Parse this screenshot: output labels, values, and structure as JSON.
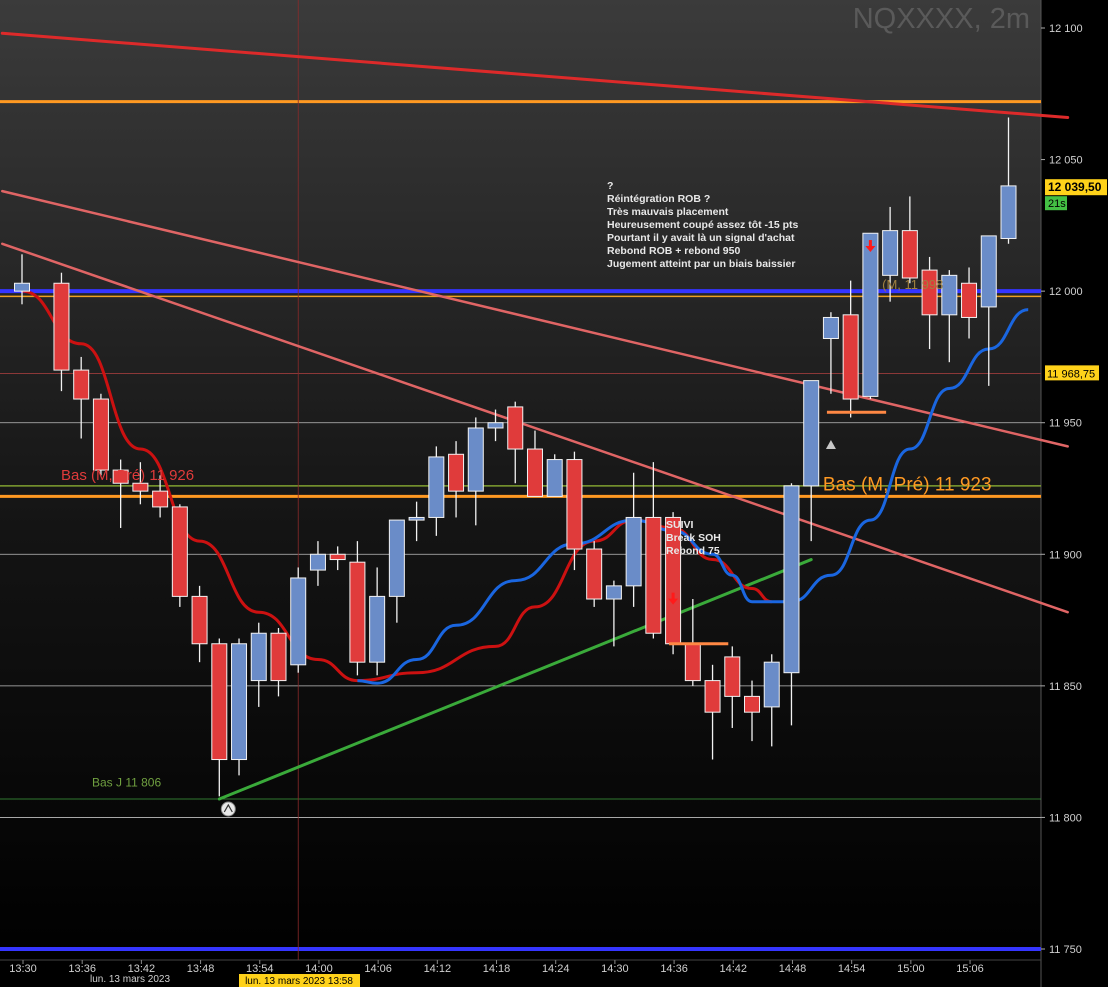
{
  "chart_data": {
    "type": "candlestick",
    "title": "NQXXXX, 2m",
    "symbol": "NQXXXX",
    "timeframe": "2m",
    "ylim": [
      11738,
      12109
    ],
    "y_ticks": [
      {
        "value": 12100,
        "label": "12 100"
      },
      {
        "value": 12050,
        "label": "12 050"
      },
      {
        "value": 12000,
        "label": "12 000"
      },
      {
        "value": 11950,
        "label": "11 950"
      },
      {
        "value": 11900,
        "label": "11 900"
      },
      {
        "value": 11850,
        "label": "11 850"
      },
      {
        "value": 11800,
        "label": "11 800"
      },
      {
        "value": 11750,
        "label": "11 750"
      }
    ],
    "x_ticks": [
      "13:30",
      "13:36",
      "13:42",
      "13:48",
      "13:54",
      "14:00",
      "14:06",
      "14:12",
      "14:18",
      "14:24",
      "14:30",
      "14:36",
      "14:42",
      "14:48",
      "14:54",
      "15:00",
      "15:06"
    ],
    "x_date_label": "lun. 13 mars 2023",
    "crosshair_time_label": "lun. 13 mars 2023 13:58",
    "last_price": {
      "label": "12 039,50",
      "timer": "21s"
    },
    "marker_price": {
      "label": "11 968,75",
      "value": 11968.75
    },
    "up_color": "#6a8cc8",
    "down_color": "#e03b3b",
    "candles": [
      {
        "time": "13:30",
        "open": 12000,
        "high": 12014,
        "low": 11995,
        "close": 12003
      },
      {
        "time": "13:34",
        "open": 12003,
        "high": 12007,
        "low": 11962,
        "close": 11970
      },
      {
        "time": "13:36",
        "open": 11970,
        "high": 11975,
        "low": 11944,
        "close": 11959
      },
      {
        "time": "13:38",
        "open": 11959,
        "high": 11961,
        "low": 11930,
        "close": 11932
      },
      {
        "time": "13:40",
        "open": 11932,
        "high": 11936,
        "low": 11910,
        "close": 11927
      },
      {
        "time": "13:42",
        "open": 11927,
        "high": 11935,
        "low": 11919,
        "close": 11924
      },
      {
        "time": "13:44",
        "open": 11924,
        "high": 11930,
        "low": 11914,
        "close": 11918
      },
      {
        "time": "13:46",
        "open": 11918,
        "high": 11919,
        "low": 11880,
        "close": 11884
      },
      {
        "time": "13:48",
        "open": 11884,
        "high": 11888,
        "low": 11859,
        "close": 11866
      },
      {
        "time": "13:50",
        "open": 11866,
        "high": 11868,
        "low": 11808,
        "close": 11822
      },
      {
        "time": "13:52",
        "open": 11822,
        "high": 11868,
        "low": 11816,
        "close": 11866
      },
      {
        "time": "13:54",
        "open": 11852,
        "high": 11874,
        "low": 11842,
        "close": 11870
      },
      {
        "time": "13:56",
        "open": 11870,
        "high": 11872,
        "low": 11846,
        "close": 11852
      },
      {
        "time": "13:58",
        "open": 11858,
        "high": 11895,
        "low": 11855,
        "close": 11891
      },
      {
        "time": "14:00",
        "open": 11894,
        "high": 11905,
        "low": 11888,
        "close": 11900
      },
      {
        "time": "14:02",
        "open": 11900,
        "high": 11903,
        "low": 11894,
        "close": 11898
      },
      {
        "time": "14:04",
        "open": 11897,
        "high": 11905,
        "low": 11854,
        "close": 11859
      },
      {
        "time": "14:06",
        "open": 11859,
        "high": 11895,
        "low": 11854,
        "close": 11884
      },
      {
        "time": "14:08",
        "open": 11884,
        "high": 11912,
        "low": 11874,
        "close": 11913
      },
      {
        "time": "14:10",
        "open": 11913,
        "high": 11920,
        "low": 11905,
        "close": 11914
      },
      {
        "time": "14:12",
        "open": 11914,
        "high": 11941,
        "low": 11907,
        "close": 11937
      },
      {
        "time": "14:14",
        "open": 11938,
        "high": 11943,
        "low": 11914,
        "close": 11924
      },
      {
        "time": "14:16",
        "open": 11924,
        "high": 11952,
        "low": 11911,
        "close": 11948
      },
      {
        "time": "14:18",
        "open": 11948,
        "high": 11955,
        "low": 11943,
        "close": 11950
      },
      {
        "time": "14:20",
        "open": 11956,
        "high": 11958,
        "low": 11927,
        "close": 11940
      },
      {
        "time": "14:22",
        "open": 11940,
        "high": 11947,
        "low": 11922,
        "close": 11922
      },
      {
        "time": "14:24",
        "open": 11922,
        "high": 11938,
        "low": 11922,
        "close": 11936
      },
      {
        "time": "14:26",
        "open": 11936,
        "high": 11939,
        "low": 11894,
        "close": 11902
      },
      {
        "time": "14:28",
        "open": 11902,
        "high": 11905,
        "low": 11880,
        "close": 11883
      },
      {
        "time": "14:30",
        "open": 11883,
        "high": 11890,
        "low": 11865,
        "close": 11888
      },
      {
        "time": "14:32",
        "open": 11888,
        "high": 11931,
        "low": 11880,
        "close": 11914
      },
      {
        "time": "14:34",
        "open": 11914,
        "high": 11935,
        "low": 11868,
        "close": 11870
      },
      {
        "time": "14:36",
        "open": 11914,
        "high": 11916,
        "low": 11862,
        "close": 11866
      },
      {
        "time": "14:38",
        "open": 11866,
        "high": 11883,
        "low": 11850,
        "close": 11852
      },
      {
        "time": "14:40",
        "open": 11852,
        "high": 11858,
        "low": 11822,
        "close": 11840
      },
      {
        "time": "14:42",
        "open": 11861,
        "high": 11865,
        "low": 11834,
        "close": 11846
      },
      {
        "time": "14:44",
        "open": 11846,
        "high": 11852,
        "low": 11829,
        "close": 11840
      },
      {
        "time": "14:46",
        "open": 11842,
        "high": 11862,
        "low": 11827,
        "close": 11859
      },
      {
        "time": "14:48",
        "open": 11855,
        "high": 11927,
        "low": 11835,
        "close": 11926
      },
      {
        "time": "14:50",
        "open": 11926,
        "high": 11966,
        "low": 11905,
        "close": 11966
      },
      {
        "time": "14:52",
        "open": 11982,
        "high": 11992,
        "low": 11961,
        "close": 11990
      },
      {
        "time": "14:54",
        "open": 11991,
        "high": 12004,
        "low": 11952,
        "close": 11959
      },
      {
        "time": "14:56",
        "open": 11960,
        "high": 12008,
        "low": 11959,
        "close": 12022
      },
      {
        "time": "14:58",
        "open": 12006,
        "high": 12032,
        "low": 11996,
        "close": 12023
      },
      {
        "time": "15:00",
        "open": 12023,
        "high": 12036,
        "low": 12003,
        "close": 12005
      },
      {
        "time": "15:02",
        "open": 12008,
        "high": 12013,
        "low": 11978,
        "close": 11991
      },
      {
        "time": "15:04",
        "open": 11991,
        "high": 12008,
        "low": 11973,
        "close": 12006
      },
      {
        "time": "15:06",
        "open": 12003,
        "high": 12009,
        "low": 11982,
        "close": 11990
      },
      {
        "time": "15:08",
        "open": 11994,
        "high": 12019,
        "low": 11964,
        "close": 12021
      },
      {
        "time": "15:10",
        "open": 12020,
        "high": 12066,
        "low": 12018,
        "close": 12040
      }
    ],
    "moving_averages": [
      {
        "name": "slow-ma",
        "color": "#cc1111",
        "points": [
          {
            "time": "13:30",
            "value": 12000
          },
          {
            "time": "13:36",
            "value": 11980
          },
          {
            "time": "13:42",
            "value": 11940
          },
          {
            "time": "13:48",
            "value": 11905
          },
          {
            "time": "13:54",
            "value": 11878
          },
          {
            "time": "14:00",
            "value": 11860
          },
          {
            "time": "14:04",
            "value": 11852
          },
          {
            "time": "14:10",
            "value": 11855
          },
          {
            "time": "14:18",
            "value": 11865
          },
          {
            "time": "14:22",
            "value": 11880
          },
          {
            "time": "14:28",
            "value": 11905
          },
          {
            "time": "14:32",
            "value": 11913
          },
          {
            "time": "14:36",
            "value": 11910
          },
          {
            "time": "14:40",
            "value": 11898
          },
          {
            "time": "14:44",
            "value": 11887
          },
          {
            "time": "14:46",
            "value": 11882
          }
        ]
      },
      {
        "name": "fast-ma",
        "color": "#1a66e0",
        "points": [
          {
            "time": "14:04",
            "value": 11852
          },
          {
            "time": "14:06",
            "value": 11851
          },
          {
            "time": "14:10",
            "value": 11860
          },
          {
            "time": "14:14",
            "value": 11873
          },
          {
            "time": "14:20",
            "value": 11890
          },
          {
            "time": "14:26",
            "value": 11904
          },
          {
            "time": "14:32",
            "value": 11913
          },
          {
            "time": "14:36",
            "value": 11909
          },
          {
            "time": "14:40",
            "value": 11900
          },
          {
            "time": "14:42",
            "value": 11892
          },
          {
            "time": "14:44",
            "value": 11882
          },
          {
            "time": "14:48",
            "value": 11882
          },
          {
            "time": "14:52",
            "value": 11892
          },
          {
            "time": "14:56",
            "value": 11913
          },
          {
            "time": "15:00",
            "value": 11940
          },
          {
            "time": "15:04",
            "value": 11963
          },
          {
            "time": "15:08",
            "value": 11978
          },
          {
            "time": "15:12",
            "value": 11993
          }
        ]
      }
    ],
    "horizontal_levels": [
      {
        "name": "orange-high",
        "value": 12072,
        "color": "#ff9922",
        "width": 3
      },
      {
        "name": "blue-12000",
        "value": 12000,
        "color": "#3535ff",
        "width": 4
      },
      {
        "name": "orange-11998",
        "value": 11998,
        "color": "#f0a020",
        "width": 1.5
      },
      {
        "name": "red-11968",
        "value": 11968.75,
        "color": "#b04040",
        "width": 0.8
      },
      {
        "name": "white-11950",
        "value": 11950,
        "color": "#bfbfbf",
        "width": 0.8
      },
      {
        "name": "green-11926",
        "value": 11926,
        "color": "#80a030",
        "width": 1.5
      },
      {
        "name": "orange-11923",
        "value": 11922,
        "color": "#ff9922",
        "width": 3
      },
      {
        "name": "white-11900",
        "value": 11900,
        "color": "#bfbfbf",
        "width": 0.8
      },
      {
        "name": "white-11850",
        "value": 11850,
        "color": "#bfbfbf",
        "width": 0.8
      },
      {
        "name": "green-11806",
        "value": 11807,
        "color": "#40a040",
        "width": 0.8
      },
      {
        "name": "white-11800",
        "value": 11800,
        "color": "#bfbfbf",
        "width": 0.8
      },
      {
        "name": "blue-11750",
        "value": 11750,
        "color": "#3535ff",
        "width": 4
      }
    ],
    "trend_lines": [
      {
        "name": "red-resistance",
        "color": "#dd2a2a",
        "width": 3,
        "from": {
          "time": "13:28",
          "value": 12098
        },
        "to": {
          "time": "15:16",
          "value": 12066
        }
      },
      {
        "name": "pink-trend-upper",
        "color": "#e06565",
        "width": 2.5,
        "from": {
          "time": "13:28",
          "value": 12038
        },
        "to": {
          "time": "15:16",
          "value": 11941
        }
      },
      {
        "name": "pink-trend-lower",
        "color": "#e06565",
        "width": 2.5,
        "from": {
          "time": "13:28",
          "value": 12018
        },
        "to": {
          "time": "15:16",
          "value": 11878
        }
      },
      {
        "name": "green-support",
        "color": "#3aaa3a",
        "width": 3,
        "from": {
          "time": "13:50",
          "value": 11807
        },
        "to": {
          "time": "14:50",
          "value": 11898
        }
      }
    ],
    "level_labels": [
      {
        "name": "bas-pre-11926-label",
        "text": "Bas (M, Pré) 11 926",
        "color": "#e03b3b",
        "time": "13:29",
        "value": 11926
      },
      {
        "name": "bas-pre-11923-label",
        "text": "Bas (M, Pré) 11 923",
        "color": "#ff9922",
        "time": "14:52",
        "value": 11922
      },
      {
        "name": "bas-m-11998-label",
        "text": "(M, 11 998",
        "color": "#a08040",
        "time": "14:58",
        "value": 12000
      },
      {
        "name": "bas-j-11806-label",
        "text": "Bas J 11 806",
        "color": "#70a040",
        "time": "13:34",
        "value": 11809
      }
    ],
    "annotations": [
      {
        "name": "rob-annotation",
        "lines": [
          "?",
          "Réintégration ROB ?",
          "Très mauvais placement",
          "Heureusement coupé assez tôt -15 pts",
          "Pourtant il y avait là un signal d'achat",
          "Rebond ROB + rebond 950",
          "Jugement atteint par un biais baissier"
        ]
      },
      {
        "name": "suivi-annotation",
        "lines": [
          "SUIVI",
          "Break SOH",
          "Rebond 75"
        ]
      }
    ],
    "arrows": [
      {
        "name": "sell-arrow-left",
        "color": "#ff1a1a",
        "direction": "down",
        "time": "14:36",
        "value": 11882
      },
      {
        "name": "sell-arrow-right",
        "color": "#ff1a1a",
        "direction": "down",
        "time": "14:56",
        "value": 12016
      },
      {
        "name": "gray-up-arrow",
        "color": "#c8c8c8",
        "direction": "up",
        "time": "14:52",
        "value": 11940
      }
    ],
    "stop_marks": [
      {
        "name": "orange-stop-left",
        "color": "#ff8844",
        "from": "14:36",
        "to": "14:42",
        "value": 11866
      },
      {
        "name": "orange-stop-right",
        "color": "#ff8844",
        "from": "14:52",
        "to": "14:58",
        "value": 11954
      }
    ],
    "grid": false,
    "legend": "none"
  }
}
